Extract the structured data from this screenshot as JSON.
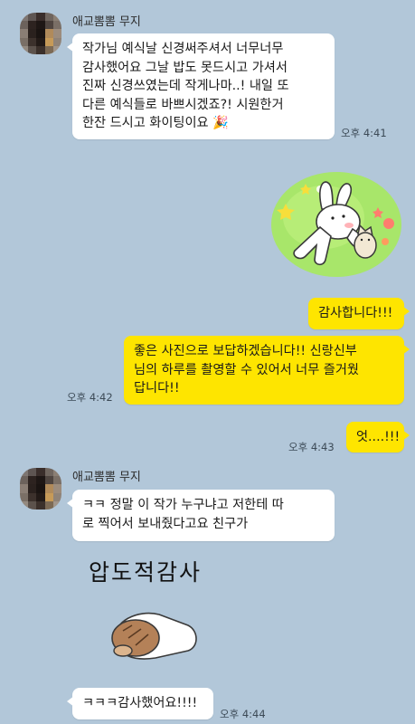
{
  "chat": {
    "messages": [
      {
        "sender": "애교뽐뽐 무지",
        "text": "작가님 예식날 신경써주셔서 너무너무\n감사했어요 그날 밥도 못드시고 가셔서\n진짜 신경쓰였는데 작게나마..! 내일 또\n다른 예식들로 바쁘시겠죠?! 시원한거\n한잔 드시고 화이팅이요 🎉",
        "time": "오후 4:41"
      },
      {
        "sticker": "bunny-cat-sticker"
      },
      {
        "text": "감사합니다!!!"
      },
      {
        "text": "좋은 사진으로 보답하겠습니다!! 신랑신부\n님의 하루를 촬영할 수 있어서 너무 즐거웠\n답니다!!",
        "time": "오후 4:42"
      },
      {
        "text": "엇....!!!",
        "time": "오후 4:43"
      },
      {
        "sender": "애교뽐뽐 무지",
        "text": "ㅋㅋ 정말 이 작가 누구냐고 저한테 따\n로 찍어서 보내줬다고요 친구가"
      },
      {
        "sticker_text": "압도적감사",
        "sticker": "hamster-sticker"
      },
      {
        "text": "ㅋㅋㅋ감사했어요!!!!",
        "time": "오후 4:44"
      }
    ]
  },
  "colors": {
    "background": "#b2c7d9",
    "my_bubble": "#fee500",
    "their_bubble": "#ffffff"
  }
}
